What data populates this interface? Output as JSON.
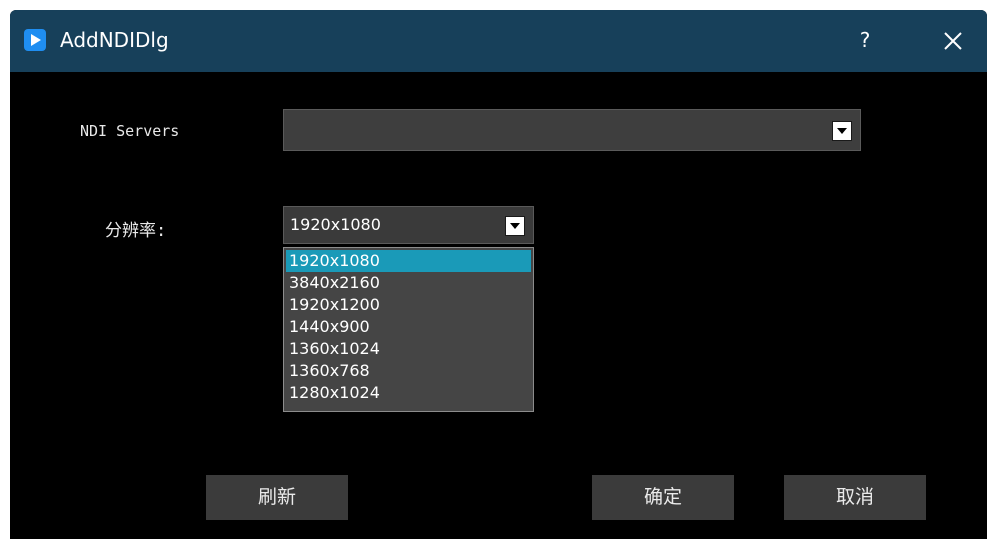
{
  "window": {
    "title": "AddNDIDlg",
    "help_label": "?",
    "close_icon": "close-icon",
    "app_icon": "play-icon",
    "titlebar_color": "#17405a"
  },
  "form": {
    "servers_label": "NDI Servers",
    "servers_value": "",
    "resolution_label": "分辨率:",
    "resolution_value": "1920x1080"
  },
  "dropdown": {
    "options": [
      "1920x1080",
      "3840x2160",
      "1920x1200",
      "1440x900",
      "1360x1024",
      "1360x768",
      "1280x1024"
    ],
    "selected_index": 0,
    "highlight_color": "#1a9ab8"
  },
  "buttons": {
    "refresh": "刷新",
    "ok": "确定",
    "cancel": "取消"
  }
}
